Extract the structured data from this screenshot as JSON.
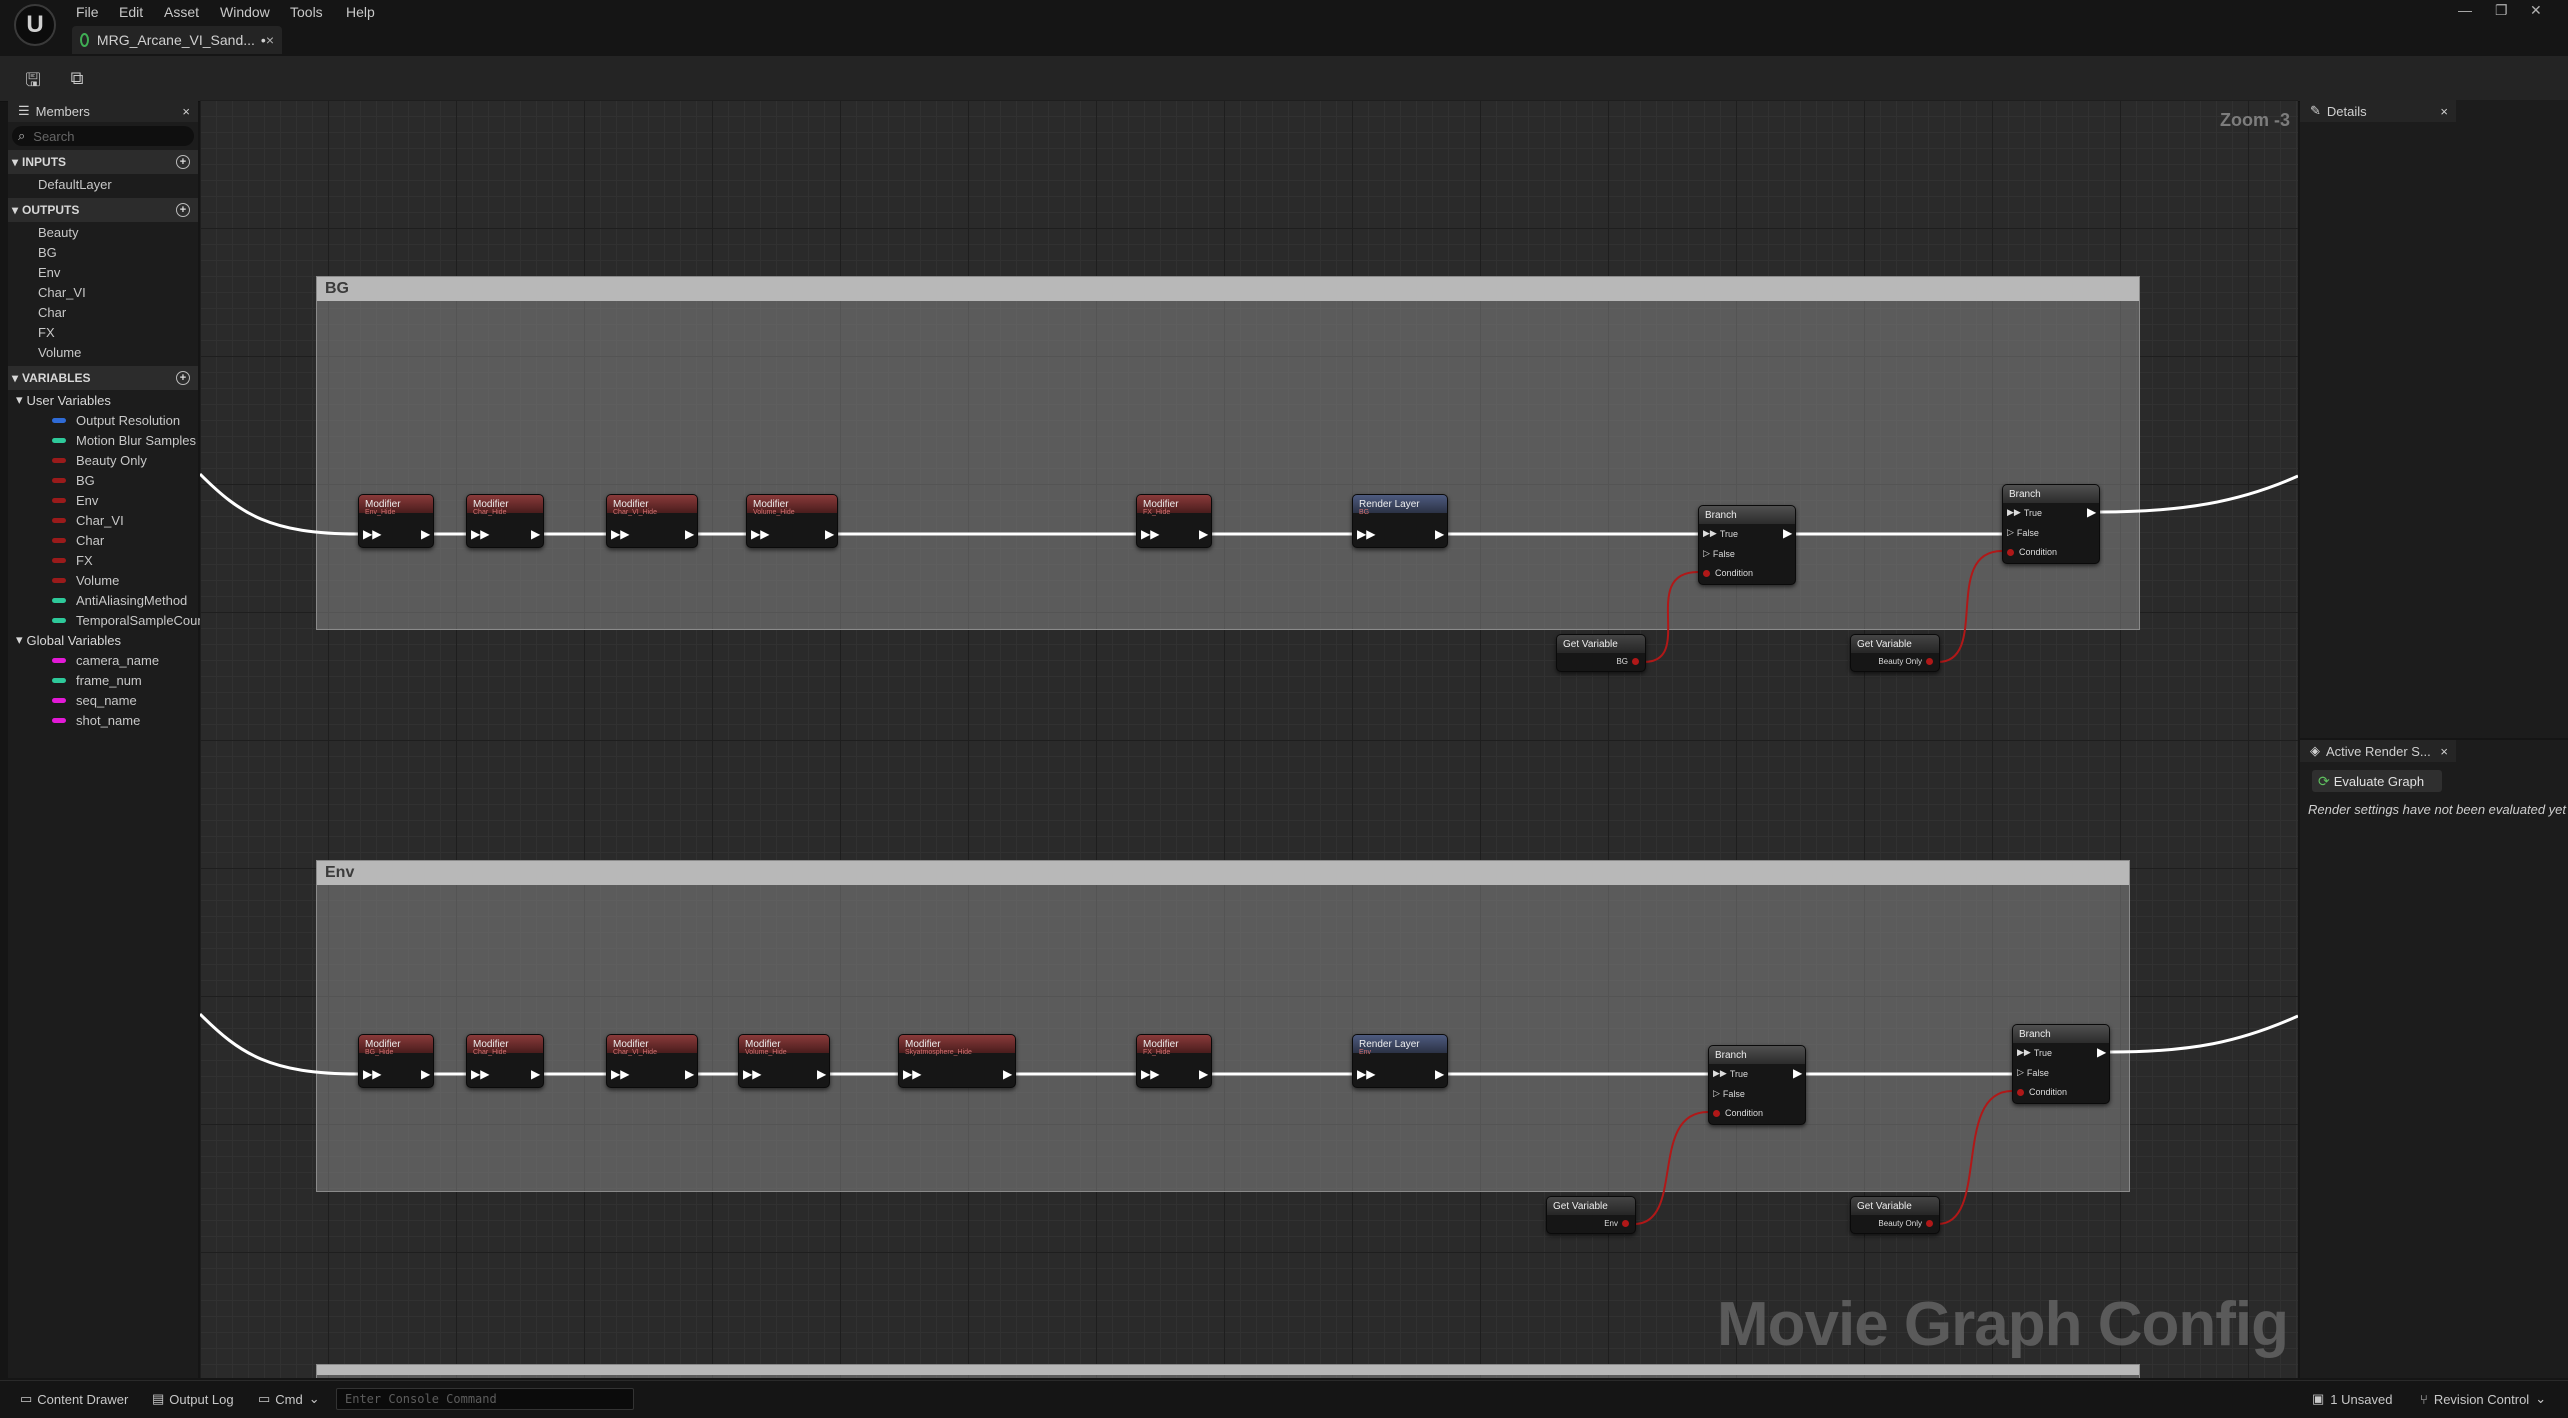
{
  "menu": {
    "items": [
      "File",
      "Edit",
      "Asset",
      "Window",
      "Tools",
      "Help"
    ],
    "logo": "U"
  },
  "tab": {
    "title": "MRG_Arcane_VI_Sand...",
    "modified": "•",
    "close": "×"
  },
  "members": {
    "panel_title": "Members",
    "search_placeholder": "Search",
    "inputs_label": "INPUTS",
    "inputs": [
      "DefaultLayer"
    ],
    "outputs_label": "OUTPUTS",
    "outputs": [
      "Beauty",
      "BG",
      "Env",
      "Char_VI",
      "Char",
      "FX",
      "Volume"
    ],
    "variables_label": "VARIABLES",
    "user_variables_label": "User Variables",
    "user_variables": [
      {
        "name": "Output Resolution",
        "color": "#2f6bd6"
      },
      {
        "name": "Motion Blur Samples",
        "color": "#2ec99a"
      },
      {
        "name": "Beauty Only",
        "color": "#9a1b1b"
      },
      {
        "name": "BG",
        "color": "#9a1b1b"
      },
      {
        "name": "Env",
        "color": "#9a1b1b"
      },
      {
        "name": "Char_VI",
        "color": "#9a1b1b"
      },
      {
        "name": "Char",
        "color": "#9a1b1b"
      },
      {
        "name": "FX",
        "color": "#9a1b1b"
      },
      {
        "name": "Volume",
        "color": "#9a1b1b"
      },
      {
        "name": "AntiAliasingMethod",
        "color": "#2ec99a"
      },
      {
        "name": "TemporalSampleCoun",
        "color": "#2ec99a"
      }
    ],
    "global_variables_label": "Global Variables",
    "global_variables": [
      {
        "name": "camera_name",
        "color": "#e21ad6"
      },
      {
        "name": "frame_num",
        "color": "#2ec99a"
      },
      {
        "name": "seq_name",
        "color": "#e21ad6"
      },
      {
        "name": "shot_name",
        "color": "#e21ad6"
      }
    ]
  },
  "graph": {
    "zoom": "Zoom -3",
    "watermark": "Movie Graph Config",
    "comments": [
      {
        "title": "BG",
        "modifiers": [
          {
            "label": "Modifier",
            "sub": "Env_Hide"
          },
          {
            "label": "Modifier",
            "sub": "Char_Hide"
          },
          {
            "label": "Modifier",
            "sub": "Char_VI_Hide"
          },
          {
            "label": "Modifier",
            "sub": "Volume_Hide"
          },
          {
            "label": "Modifier",
            "sub": "FX_Hide"
          }
        ],
        "render_layer": {
          "label": "Render Layer",
          "sub": "BG"
        },
        "branch1": {
          "label": "Branch",
          "pins": [
            "True",
            "False",
            "Condition"
          ]
        },
        "branch2": {
          "label": "Branch",
          "pins": [
            "True",
            "False",
            "Condition"
          ]
        },
        "getvar1": {
          "label": "Get Variable",
          "value": "BG"
        },
        "getvar2": {
          "label": "Get Variable",
          "value": "Beauty Only"
        }
      },
      {
        "title": "Env",
        "modifiers": [
          {
            "label": "Modifier",
            "sub": "BG_Hide"
          },
          {
            "label": "Modifier",
            "sub": "Char_Hide"
          },
          {
            "label": "Modifier",
            "sub": "Char_VI_Hide"
          },
          {
            "label": "Modifier",
            "sub": "Volume_Hide"
          },
          {
            "label": "Modifier",
            "sub": "Skyatmosphere_Hide"
          },
          {
            "label": "Modifier",
            "sub": "FX_Hide"
          }
        ],
        "render_layer": {
          "label": "Render Layer",
          "sub": "Env"
        },
        "branch1": {
          "label": "Branch",
          "pins": [
            "True",
            "False",
            "Condition"
          ]
        },
        "branch2": {
          "label": "Branch",
          "pins": [
            "True",
            "False",
            "Condition"
          ]
        },
        "getvar1": {
          "label": "Get Variable",
          "value": "Env"
        },
        "getvar2": {
          "label": "Get Variable",
          "value": "Beauty Only"
        }
      }
    ]
  },
  "details": {
    "title": "Details"
  },
  "active_render": {
    "title": "Active Render S...",
    "evaluate_label": "Evaluate Graph",
    "message": "Render settings have not been evaluated yet"
  },
  "statusbar": {
    "content_drawer": "Content Drawer",
    "output_log": "Output Log",
    "cmd": "Cmd",
    "console_placeholder": "Enter Console Command",
    "unsaved": "1 Unsaved",
    "revision_control": "Revision Control"
  },
  "colors": {
    "modifier_header": "#8a3a3a",
    "render_layer_header": "#4e5b80",
    "condition_pin": "#b01818",
    "wire": "#ffffff"
  }
}
